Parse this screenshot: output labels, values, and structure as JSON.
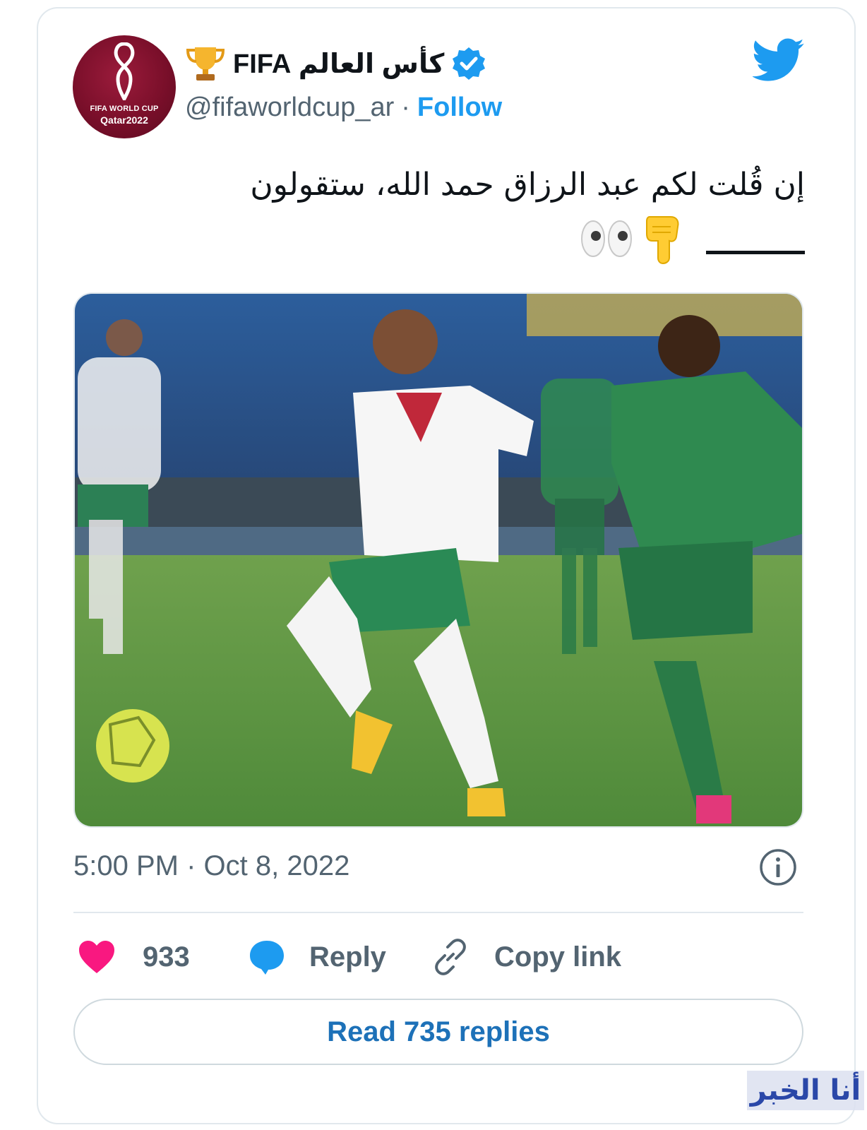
{
  "account": {
    "display_name": "كأس العالم FIFA",
    "handle": "@fifaworldcup_ar",
    "separator": "·",
    "follow_label": "Follow",
    "avatar_text_line1": "FIFA WORLD CUP",
    "avatar_text_line2": "Qatar2022",
    "trophy_icon": "trophy-emoji",
    "verified_icon": "verified-badge",
    "brand_color": "#1d9bf0"
  },
  "tweet": {
    "text_line1": "إن قُلت لكم عبد الرزاق حمد الله، ستقولون",
    "emoji_line2": [
      "backhand-index-pointing-down-emoji",
      "eyes-emoji"
    ],
    "image_alt": "Football match photo: Morocco player number 20 in white and green kit controls the ball while Burkina Faso player number 12 in green chases",
    "timestamp": "5:00 PM · Oct 8, 2022"
  },
  "actions": {
    "like_count": "933",
    "reply_label": "Reply",
    "copy_link_label": "Copy link",
    "like_color": "#f91880",
    "reply_icon_color": "#1d9bf0"
  },
  "read_replies_label": "Read 735 replies",
  "watermark_text": "أنا الخبر"
}
